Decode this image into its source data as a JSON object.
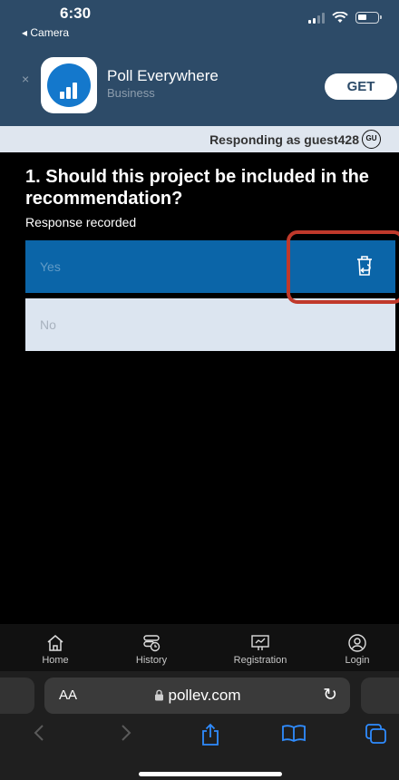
{
  "status_bar": {
    "time": "6:30",
    "back_app": "◂ Camera"
  },
  "app_banner": {
    "name": "Poll Everywhere",
    "category": "Business",
    "get_label": "GET",
    "close_glyph": "×"
  },
  "responding": {
    "text": "Responding as guest428",
    "avatar_initials": "GU"
  },
  "question": {
    "title": "1. Should this project be included in the recommendation?",
    "status": "Response recorded",
    "options": [
      {
        "label": "Yes",
        "selected": true
      },
      {
        "label": "No",
        "selected": false
      }
    ]
  },
  "tabbar": [
    {
      "label": "Home",
      "icon": "home-icon"
    },
    {
      "label": "History",
      "icon": "history-icon"
    },
    {
      "label": "Registration",
      "icon": "registration-icon"
    },
    {
      "label": "Login",
      "icon": "login-icon"
    }
  ],
  "safari": {
    "aa_label": "AA",
    "domain": "pollev.com",
    "reload_glyph": "↻"
  },
  "colors": {
    "header_bg": "#2d4b68",
    "selected_option": "#0b65a8",
    "unselected_option": "#dce5f0",
    "highlight": "#c0392b"
  }
}
